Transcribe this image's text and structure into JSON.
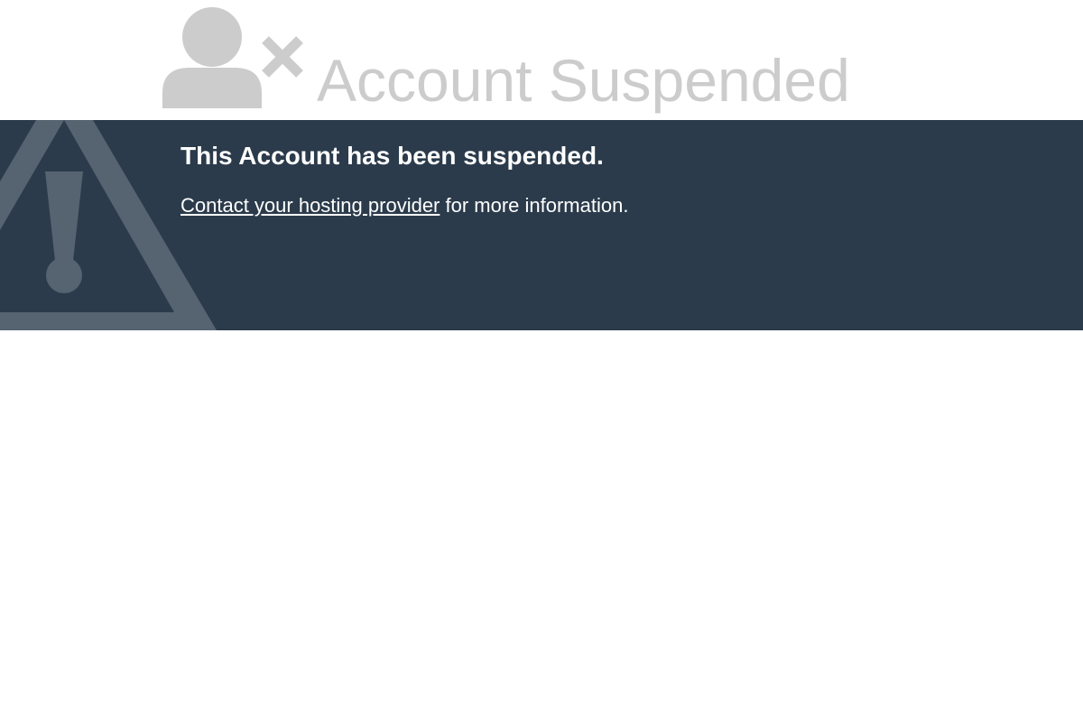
{
  "header": {
    "title": "Account Suspended",
    "icon": "user-suspended-icon"
  },
  "banner": {
    "heading": "This Account has been suspended.",
    "link_text": "Contact your hosting provider",
    "message_suffix": " for more information.",
    "icon": "warning-icon"
  },
  "colors": {
    "banner_background": "#2b3b4b",
    "icon_grey": "#cccccc",
    "warning_triangle": "#566370",
    "text_white": "#ffffff"
  }
}
